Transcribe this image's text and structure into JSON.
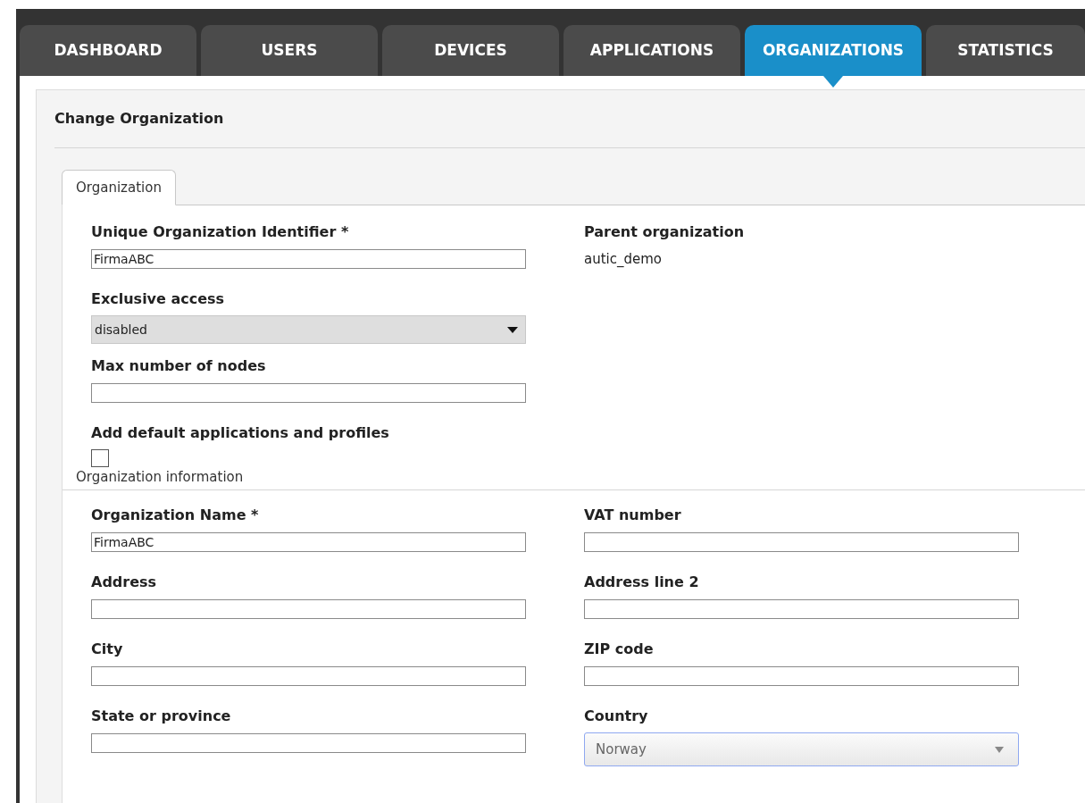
{
  "tabs": [
    {
      "label": "DASHBOARD",
      "selected": false
    },
    {
      "label": "USERS",
      "selected": false
    },
    {
      "label": "DEVICES",
      "selected": false
    },
    {
      "label": "APPLICATIONS",
      "selected": false
    },
    {
      "label": "ORGANIZATIONS",
      "selected": true
    },
    {
      "label": "STATISTICS",
      "selected": false
    }
  ],
  "panel_title": "Change Organization",
  "sub_tabs": [
    {
      "label": "Organization",
      "selected": true
    }
  ],
  "general": {
    "left": [
      {
        "kind": "text",
        "label": "Unique Organization Identifier *",
        "value": "FirmaABC"
      },
      {
        "kind": "select",
        "label": "Exclusive access",
        "value": "disabled",
        "disabled": true
      },
      {
        "kind": "text",
        "label": "Max number of nodes"
      },
      {
        "kind": "checkbox",
        "label": "Add default applications and profiles",
        "checked": false
      }
    ],
    "right": [
      {
        "kind": "static",
        "label": "Parent organization",
        "value": "autic_demo"
      }
    ]
  },
  "info_section": {
    "title": "Organization information",
    "rows": [
      [
        {
          "kind": "text",
          "label": "Organization Name *",
          "value": "FirmaABC"
        },
        {
          "kind": "text",
          "label": "VAT number"
        }
      ],
      [
        {
          "kind": "text",
          "label": "Address"
        },
        {
          "kind": "text",
          "label": "Address line 2"
        }
      ],
      [
        {
          "kind": "text",
          "label": "City"
        },
        {
          "kind": "text",
          "label": "ZIP code"
        }
      ],
      [
        {
          "kind": "text",
          "label": "State or province"
        },
        {
          "kind": "select",
          "label": "Country",
          "value": "Norway",
          "disabled": false
        }
      ]
    ]
  }
}
